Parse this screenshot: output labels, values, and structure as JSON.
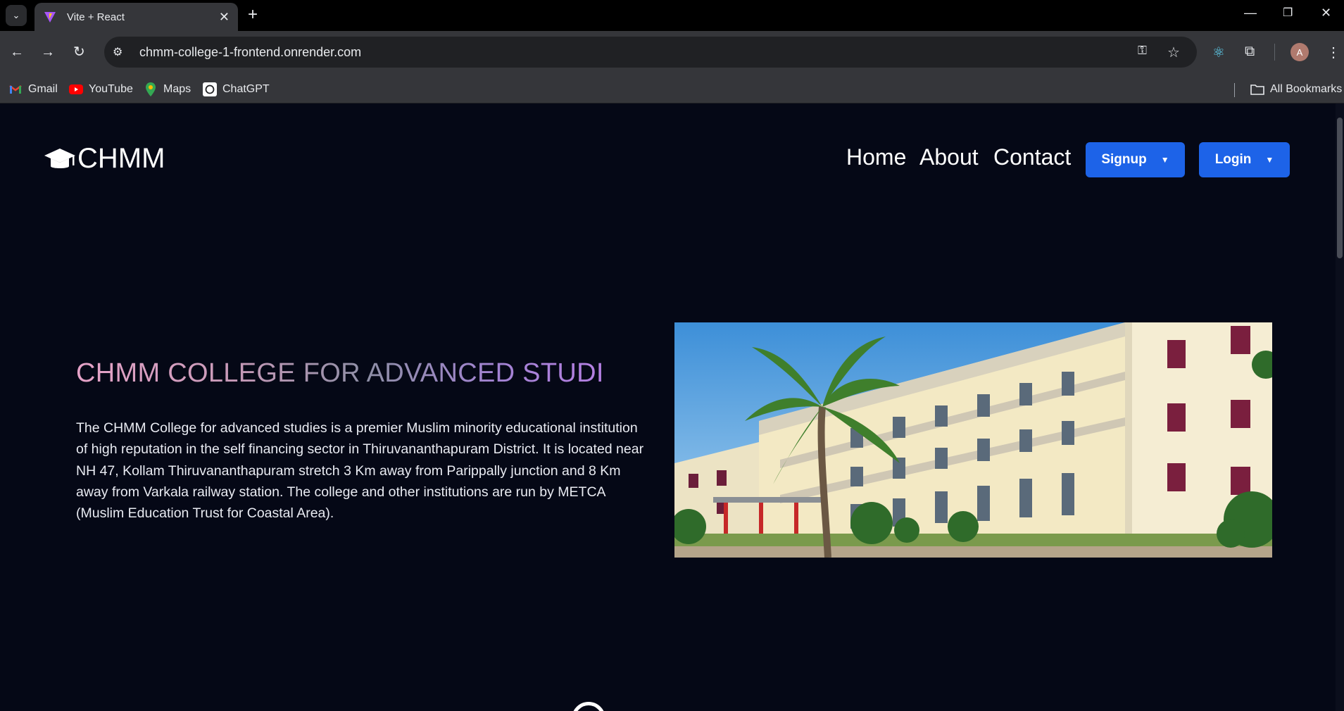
{
  "browser": {
    "tab_title": "Vite + React",
    "url": "chmm-college-1-frontend.onrender.com",
    "bookmarks": [
      "Gmail",
      "YouTube",
      "Maps",
      "ChatGPT"
    ],
    "all_bookmarks": "All Bookmarks",
    "avatar_letter": "A"
  },
  "site": {
    "logo_text": "CHMM",
    "nav": {
      "home": "Home",
      "about": "About",
      "contact": "Contact"
    },
    "signup_label": "Signup",
    "login_label": "Login",
    "hero_title": "CHMM COLLEGE FOR ADVANCED STUDI",
    "hero_text": "The CHMM College for advanced studies is a premier Muslim minority educational institution of high reputation in the self financing sector in Thiruvananthapuram District. It is located near NH 47, Kollam Thiruvananthapuram stretch 3 Km away from Parippally junction and 8 Km away from Varkala railway station. The college and other institutions are run by METCA (Muslim Education Trust for Coastal Area)."
  },
  "colors": {
    "page_bg": "#050816",
    "button_blue": "#1d63e8"
  }
}
